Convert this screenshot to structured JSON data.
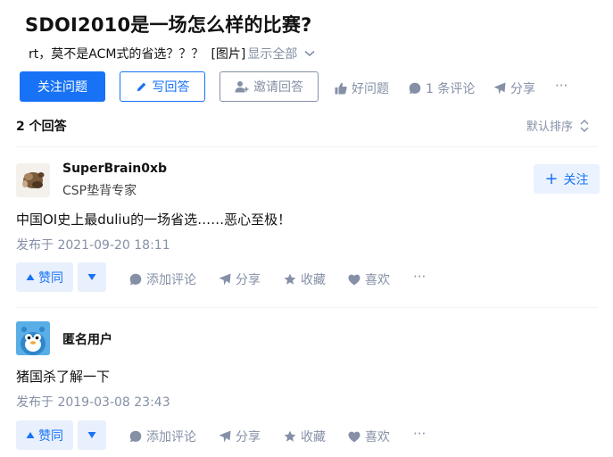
{
  "question": {
    "title": "SDOI2010是一场怎么样的比赛?",
    "detail_text": "rt，莫不是ACM式的省选？？？",
    "image_tag": "[图片]",
    "show_all": "显示全部"
  },
  "actions": {
    "follow_question": "关注问题",
    "write_answer": "写回答",
    "invite_answer": "邀请回答",
    "good_question": "好问题",
    "comments": "1 条评论",
    "share": "分享",
    "more": "···"
  },
  "answers_header": {
    "count_label": "2 个回答",
    "sort_label": "默认排序"
  },
  "answers": [
    {
      "author_name": "SuperBrain0xb",
      "author_badge": "CSP垫背专家",
      "follow_label": "关注",
      "content": "中国OI史上最duliu的一场省选……恶心至极！",
      "date": "发布于 2021-09-20 18:11",
      "vote_up": "赞同",
      "comment": "添加评论",
      "share": "分享",
      "collect": "收藏",
      "like": "喜欢",
      "more": "···"
    },
    {
      "author_name": "匿名用户",
      "content": "猪国杀了解一下",
      "date": "发布于 2019-03-08 23:43",
      "vote_up": "赞同",
      "comment": "添加评论",
      "share": "分享",
      "collect": "收藏",
      "like": "喜欢",
      "more": "···"
    }
  ],
  "colors": {
    "brand_blue": "#1772f6",
    "muted_gray": "#8590a6",
    "vote_bg": "#e8f0fd"
  },
  "icons": [
    "pencil-icon",
    "invite-user-icon",
    "thumbs-up-icon",
    "comment-bubble-icon",
    "share-arrow-icon",
    "chevron-down-icon",
    "sort-arrows-icon",
    "triangle-up-icon",
    "triangle-down-icon",
    "star-icon",
    "heart-icon"
  ]
}
